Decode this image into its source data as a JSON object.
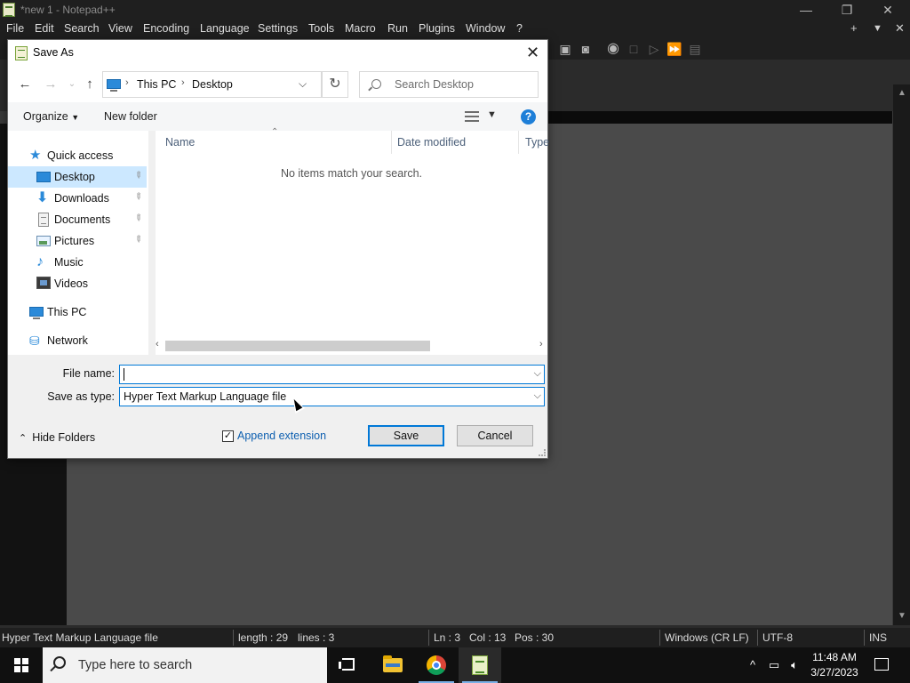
{
  "notepad": {
    "window_title": "*new 1 - Notepad++",
    "window_controls": {
      "minimize": "—",
      "restore": "❐",
      "close": "✕"
    },
    "menu": [
      "File",
      "Edit",
      "Search",
      "View",
      "Encoding",
      "Language",
      "Settings",
      "Tools",
      "Macro",
      "Run",
      "Plugins",
      "Window",
      "?"
    ],
    "menu_right": {
      "add": "+",
      "dropdown": "▼",
      "close": "✕"
    },
    "status": {
      "file_type": "Hyper Text Markup Language file",
      "length": "length : 29",
      "lines": "lines : 3",
      "ln": "Ln : 3",
      "col": "Col : 13",
      "pos": "Pos : 30",
      "eol": "Windows (CR LF)",
      "encoding": "UTF-8",
      "mode": "INS"
    }
  },
  "dialog": {
    "title": "Save As",
    "close_label": "✕",
    "address": {
      "root": "This PC",
      "current": "Desktop"
    },
    "search_placeholder": "Search Desktop",
    "toolbar": {
      "organize": "Organize",
      "new_folder": "New folder",
      "help": "?"
    },
    "nav_items": [
      {
        "label": "Quick access",
        "icon": "quick-access-icon"
      },
      {
        "label": "Desktop",
        "icon": "desktop-icon",
        "selected": true,
        "pinned": true
      },
      {
        "label": "Downloads",
        "icon": "downloads-icon",
        "pinned": true
      },
      {
        "label": "Documents",
        "icon": "documents-icon",
        "pinned": true
      },
      {
        "label": "Pictures",
        "icon": "pictures-icon",
        "pinned": true
      },
      {
        "label": "Music",
        "icon": "music-icon"
      },
      {
        "label": "Videos",
        "icon": "videos-icon"
      },
      {
        "label": "This PC",
        "icon": "this-pc-icon"
      },
      {
        "label": "Network",
        "icon": "network-icon"
      }
    ],
    "columns": [
      "Name",
      "Date modified",
      "Type"
    ],
    "empty_message": "No items match your search.",
    "file_name_label": "File name:",
    "file_name_value": "",
    "save_type_label": "Save as type:",
    "save_type_value": "Hyper Text Markup Language file",
    "hide_folders": "Hide Folders",
    "append_extension": "Append extension",
    "append_checked": true,
    "save_button": "Save",
    "cancel_button": "Cancel"
  },
  "taskbar": {
    "search_placeholder": "Type here to search",
    "time": "11:48 AM",
    "date": "3/27/2023"
  },
  "colors": {
    "accent": "#0078d7",
    "selection": "#cce8ff",
    "link": "#0d5fb0",
    "dark_bg": "#1f1f1f"
  }
}
